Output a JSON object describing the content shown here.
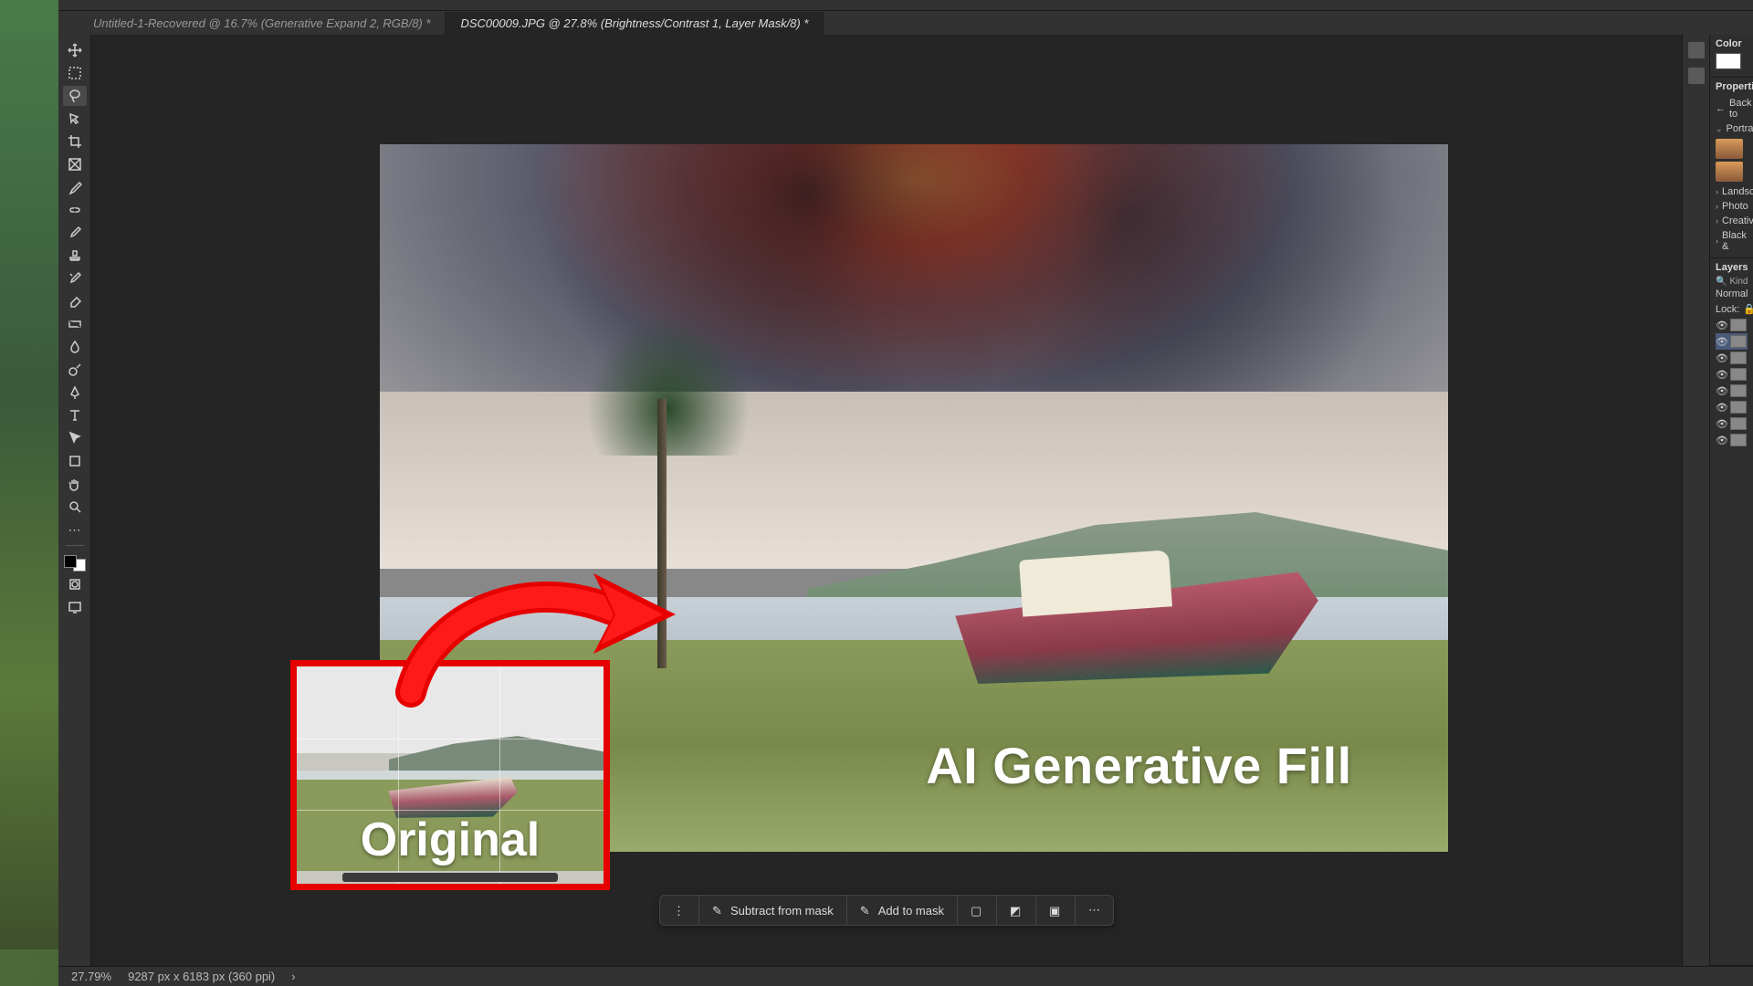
{
  "tabs": [
    {
      "label": "Untitled-1-Recovered @ 16.7% (Generative Expand 2, RGB/8) *",
      "active": false
    },
    {
      "label": "DSC00009.JPG @ 27.8% (Brightness/Contrast 1, Layer Mask/8) *",
      "active": true
    }
  ],
  "tools": [
    "move",
    "marquee",
    "lasso",
    "wand",
    "crop",
    "frame",
    "eyedropper",
    "healing",
    "brush",
    "stamp",
    "history",
    "eraser",
    "gradient",
    "blur",
    "dodge",
    "pen",
    "type",
    "path",
    "rectangle",
    "hand",
    "zoom",
    "more"
  ],
  "canvas": {
    "overlay_title": "AI Generative Fill",
    "original_label": "Original"
  },
  "context_bar": {
    "subtract": "Subtract from mask",
    "add": "Add to mask"
  },
  "status": {
    "zoom": "27.79%",
    "dims": "9287 px x 6183 px (360 ppi)"
  },
  "right": {
    "color": "Color",
    "properties": "Properties",
    "back": "Back to",
    "groups": [
      "Portrait",
      "Landscape",
      "Photo",
      "Creative",
      "Black &"
    ],
    "layers": "Layers",
    "kind": "Kind",
    "blend": "Normal",
    "lock": "Lock:"
  }
}
